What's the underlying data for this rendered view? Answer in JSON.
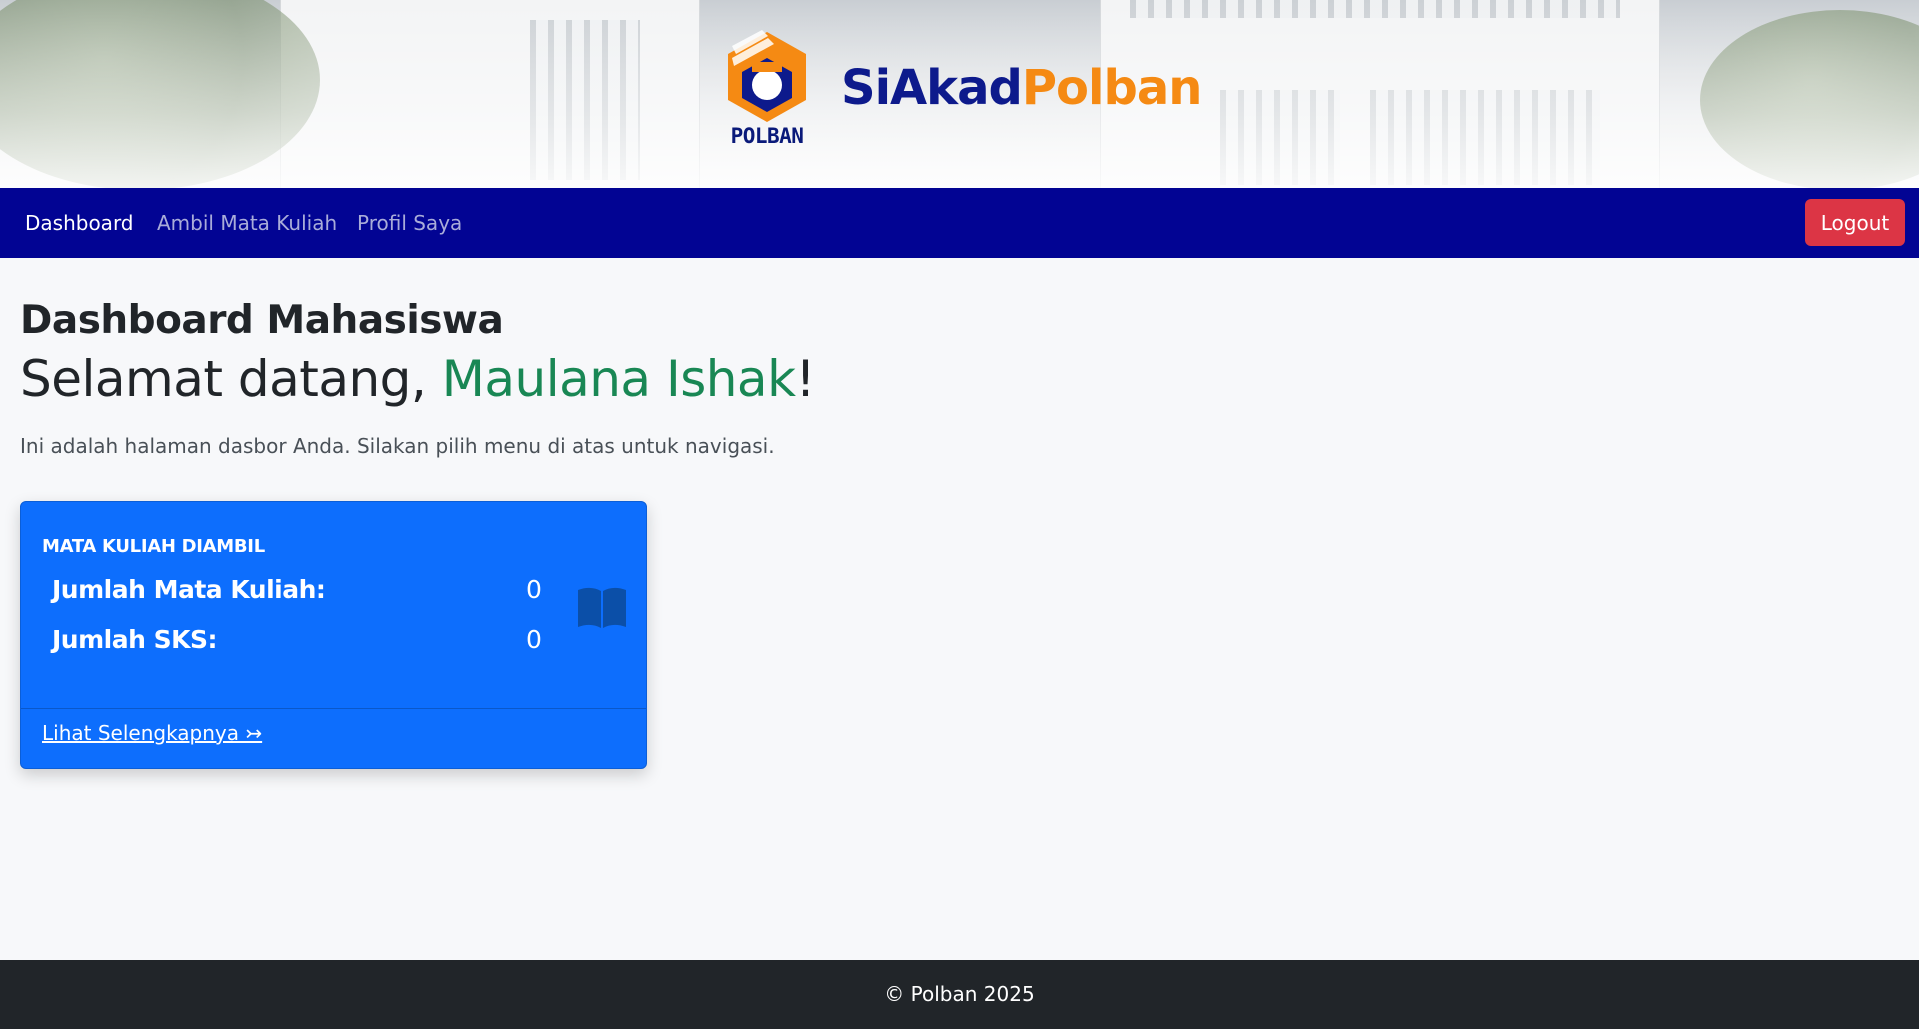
{
  "header": {
    "logo_text": "POLBAN",
    "brand_part1": "SiAkad",
    "brand_part2": "Polban"
  },
  "nav": {
    "items": [
      {
        "label": "Dashboard",
        "active": true
      },
      {
        "label": "Ambil Mata Kuliah",
        "active": false
      },
      {
        "label": "Profil Saya",
        "active": false
      }
    ],
    "logout_label": "Logout"
  },
  "main": {
    "title": "Dashboard Mahasiswa",
    "welcome_prefix": "Selamat datang, ",
    "user_name": "Maulana Ishak",
    "welcome_suffix": "!",
    "intro": "Ini adalah halaman dasbor Anda. Silakan pilih menu di atas untuk navigasi."
  },
  "card": {
    "title": "MATA KULIAH DIAMBIL",
    "stats": [
      {
        "label": "Jumlah Mata Kuliah:",
        "value": "0"
      },
      {
        "label": "Jumlah SKS:",
        "value": "0"
      }
    ],
    "icon": "book-icon",
    "link_label": "Lihat Selengkapnya ↣"
  },
  "footer": {
    "text": "© Polban 2025"
  },
  "colors": {
    "navbar": "#020493",
    "card": "#0d6efd",
    "logout": "#dc3545",
    "username": "#198754",
    "brand_navy": "#0d1a8c",
    "brand_orange": "#f58a13",
    "footer": "#212529"
  }
}
